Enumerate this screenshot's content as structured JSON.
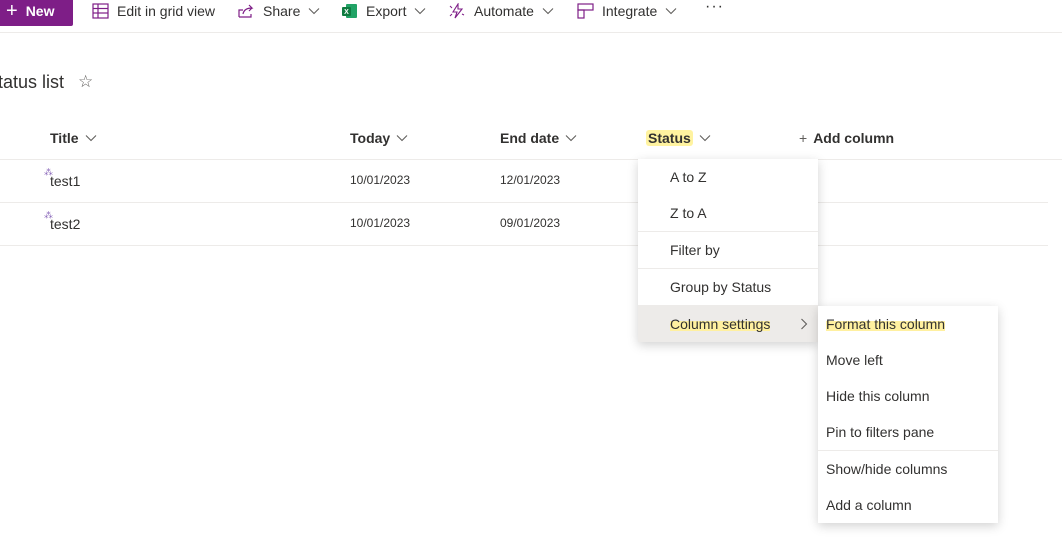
{
  "toolbar": {
    "new_label": "New",
    "edit_grid_label": "Edit in grid view",
    "share_label": "Share",
    "export_label": "Export",
    "automate_label": "Automate",
    "integrate_label": "Integrate",
    "more_label": "···"
  },
  "list": {
    "title": "tatus list",
    "columns": [
      "Title",
      "Today",
      "End date",
      "Status"
    ],
    "add_column_label": "Add column",
    "rows": [
      {
        "title": "test1",
        "today": "10/01/2023",
        "end_date": "12/01/2023"
      },
      {
        "title": "test2",
        "today": "10/01/2023",
        "end_date": "09/01/2023"
      }
    ]
  },
  "column_menu": {
    "items": [
      "A to Z",
      "Z to A",
      "Filter by",
      "Group by Status",
      "Column settings"
    ]
  },
  "settings_submenu": {
    "items": [
      "Format this column",
      "Move left",
      "Hide this column",
      "Pin to filters pane",
      "Show/hide columns",
      "Add a column"
    ]
  },
  "colors": {
    "brand": "#7e1e87",
    "highlight": "#fff0a0",
    "excel_green": "#107c41",
    "new_item_marker": "#8764b8"
  },
  "icons": [
    "plus-icon",
    "grid-icon",
    "share-icon",
    "excel-icon",
    "automate-icon",
    "integrate-icon",
    "chevron-down-icon",
    "star-icon",
    "chevron-right-icon"
  ]
}
